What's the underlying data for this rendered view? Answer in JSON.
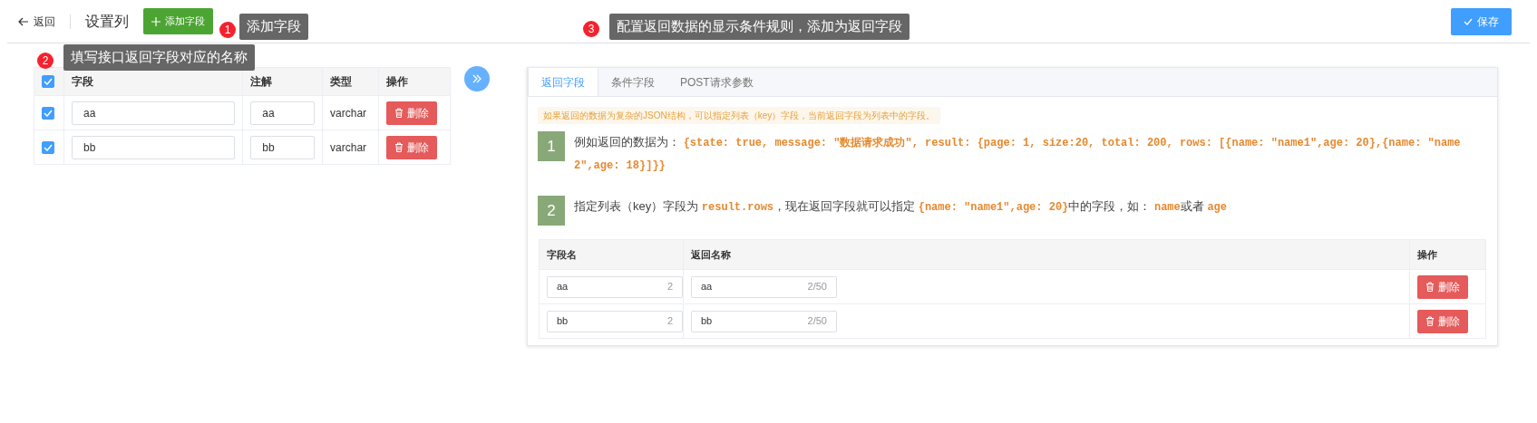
{
  "header": {
    "back_label": "返回",
    "title": "设置列",
    "add_button": "添加字段",
    "save_button": "保存"
  },
  "annotations": [
    {
      "number": "1",
      "text": "添加字段"
    },
    {
      "number": "2",
      "text": "填写接口返回字段对应的名称"
    },
    {
      "number": "3",
      "text": "配置返回数据的显示条件规则，添加为返回字段"
    }
  ],
  "fields_table": {
    "all_checked": true,
    "columns": [
      "字段",
      "注解",
      "类型",
      "操作"
    ],
    "rows": [
      {
        "checked": true,
        "field": "aa",
        "comment": "aa",
        "type": "varchar",
        "action": "删除"
      },
      {
        "checked": true,
        "field": "bb",
        "comment": "bb",
        "type": "varchar",
        "action": "删除"
      }
    ]
  },
  "tabs": [
    {
      "label": "返回字段",
      "selected": true
    },
    {
      "label": "条件字段",
      "selected": false
    },
    {
      "label": "POST请求参数",
      "selected": false
    }
  ],
  "notice": "如果返回的数据为复杂的JSON结构，可以指定列表（key）字段，当前返回字段为列表中的字段。",
  "steps": [
    {
      "number": "1",
      "segments": [
        {
          "kind": "plain",
          "text": "例如返回的数据为： "
        },
        {
          "kind": "code",
          "text": "{state: true, message: \"数据请求成功\", result: {page: 1, size:20, total: 200, rows: [{name: \"name1\",age: 20},{name: \"name2\",age: 18}]}}"
        }
      ]
    },
    {
      "number": "2",
      "segments": [
        {
          "kind": "plain",
          "text": "指定列表（key）字段为 "
        },
        {
          "kind": "code",
          "text": "result.rows"
        },
        {
          "kind": "plain",
          "text": "，现在返回字段就可以指定 "
        },
        {
          "kind": "code",
          "text": "{name: \"name1\",age: 20}"
        },
        {
          "kind": "plain",
          "text": "中的字段，如： "
        },
        {
          "kind": "code",
          "text": "name"
        },
        {
          "kind": "plain",
          "text": "或者 "
        },
        {
          "kind": "code",
          "text": "age"
        }
      ]
    }
  ],
  "return_table": {
    "columns": [
      "字段名",
      "返回名称",
      "操作"
    ],
    "rows": [
      {
        "field": "aa",
        "field_count": "2",
        "name": "aa",
        "name_count": "2/50",
        "action": "删除"
      },
      {
        "field": "bb",
        "field_count": "2",
        "name": "bb",
        "name_count": "2/50",
        "action": "删除"
      }
    ]
  }
}
